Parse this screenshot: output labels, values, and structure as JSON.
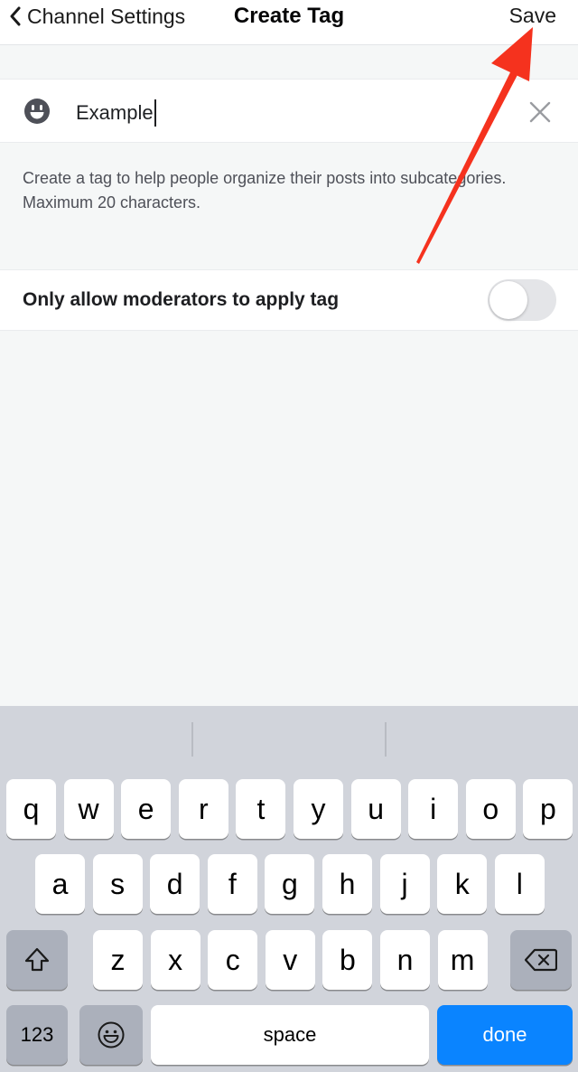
{
  "nav": {
    "back_label": "Channel Settings",
    "title": "Create Tag",
    "save_label": "Save"
  },
  "tag_input": {
    "value": "Example"
  },
  "helper_text": "Create a tag to help people organize their posts into subcategories. Maximum 20 characters.",
  "moderator_toggle": {
    "label": "Only allow moderators to apply tag",
    "on": false
  },
  "icons": {
    "back": "chevron-left-icon",
    "emoji": "smiley-face-icon",
    "clear": "close-icon",
    "shift": "shift-arrow-icon",
    "backspace": "backspace-icon",
    "keyboard_emoji": "emoji-icon"
  },
  "annotation": {
    "arrow_color": "#f5321e"
  },
  "keyboard": {
    "row1": [
      "q",
      "w",
      "e",
      "r",
      "t",
      "y",
      "u",
      "i",
      "o",
      "p"
    ],
    "row2": [
      "a",
      "s",
      "d",
      "f",
      "g",
      "h",
      "j",
      "k",
      "l"
    ],
    "row3": [
      "z",
      "x",
      "c",
      "v",
      "b",
      "n",
      "m"
    ],
    "numbers_label": "123",
    "space_label": "space",
    "done_label": "done"
  },
  "colors": {
    "done_key": "#0a84ff",
    "keyboard_bg": "#d1d4db",
    "toggle_off": "#e4e5e8"
  }
}
